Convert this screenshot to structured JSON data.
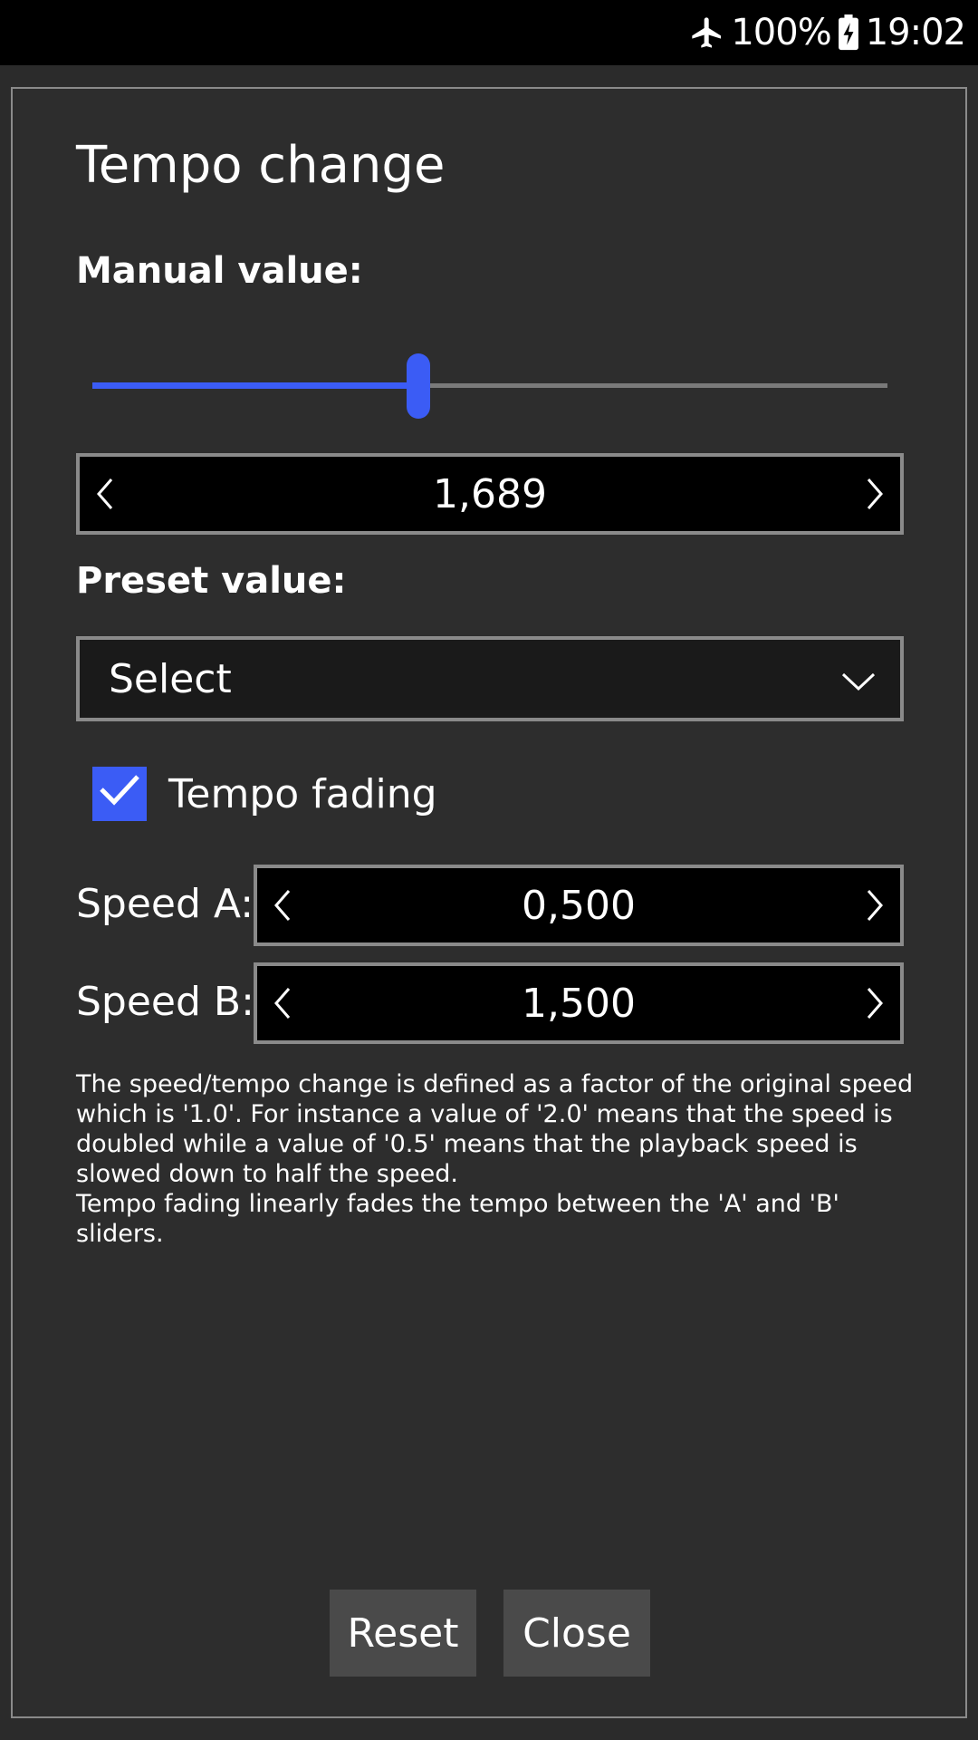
{
  "status_bar": {
    "battery": "100%",
    "time": "19:02",
    "icons": [
      "airplane-mode-icon",
      "battery-charging-icon"
    ]
  },
  "dialog": {
    "title": "Tempo change",
    "manual_label": "Manual value:",
    "manual_slider_fraction": 0.41,
    "manual_value": "1,689",
    "preset_label": "Preset value:",
    "preset_selected": "Select",
    "tempo_fading_label": "Tempo fading",
    "tempo_fading_checked": true,
    "speed_a_label": "Speed A:",
    "speed_a_value": "0,500",
    "speed_b_label": "Speed B:",
    "speed_b_value": "1,500",
    "help_line1": "The speed/tempo change is defined as a factor of the original speed which is '1.0'. For instance a value of '2.0' means that the speed is doubled while a value of '0.5' means that the playback speed is slowed down to half the speed.",
    "help_line2": "Tempo fading linearly fades the tempo between the 'A' and 'B' sliders.",
    "reset_label": "Reset",
    "close_label": "Close"
  },
  "colors": {
    "accent": "#3b5cf5",
    "dialog_bg": "#2d2d2d",
    "border": "#8a8a8a"
  }
}
